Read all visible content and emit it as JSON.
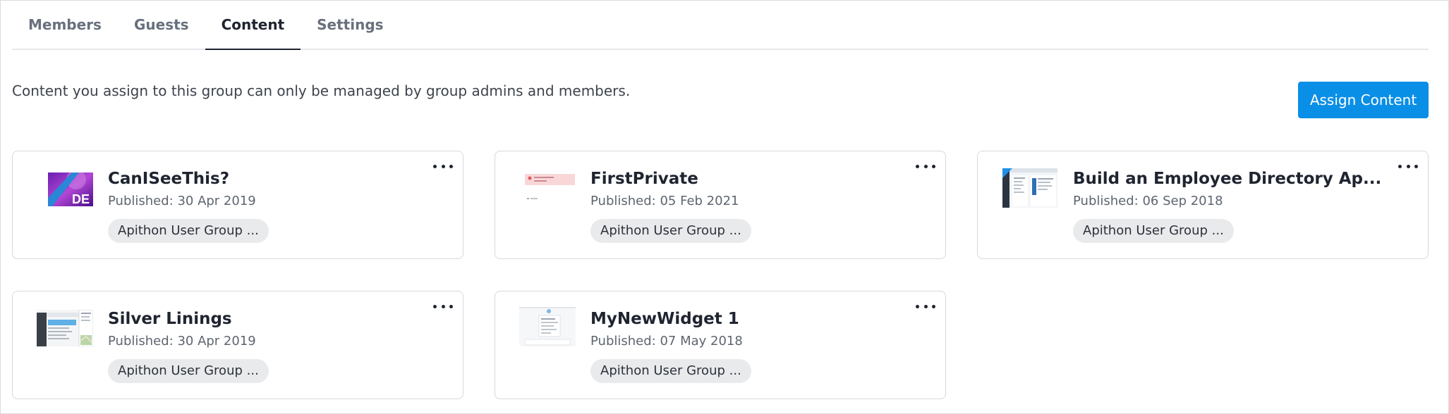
{
  "tabs": [
    {
      "label": "Members",
      "active": false
    },
    {
      "label": "Guests",
      "active": false
    },
    {
      "label": "Content",
      "active": true
    },
    {
      "label": "Settings",
      "active": false
    }
  ],
  "description": "Content you assign to this group can only be managed by group admins and members.",
  "assign_button_label": "Assign Content",
  "accent_color": "#0a8fe6",
  "cards": [
    {
      "title": "CanISeeThis?",
      "published": "Published: 30 Apr 2019",
      "group": "Apithon User Group ...",
      "thumb_icon": "purple-banner-thumbnail",
      "thumb_text": "DE"
    },
    {
      "title": "FirstPrivate",
      "published": "Published: 05 Feb 2021",
      "group": "Apithon User Group ...",
      "thumb_icon": "error-page-thumbnail"
    },
    {
      "title": "Build an Employee Directory Ap...",
      "published": "Published: 06 Sep 2018",
      "group": "Apithon User Group ...",
      "thumb_icon": "app-screenshot-thumbnail"
    },
    {
      "title": "Silver Linings",
      "published": "Published: 30 Apr 2019",
      "group": "Apithon User Group ...",
      "thumb_icon": "map-app-thumbnail"
    },
    {
      "title": "MyNewWidget 1",
      "published": "Published: 07 May 2018",
      "group": "Apithon User Group ...",
      "thumb_icon": "widget-thumbnail"
    }
  ]
}
